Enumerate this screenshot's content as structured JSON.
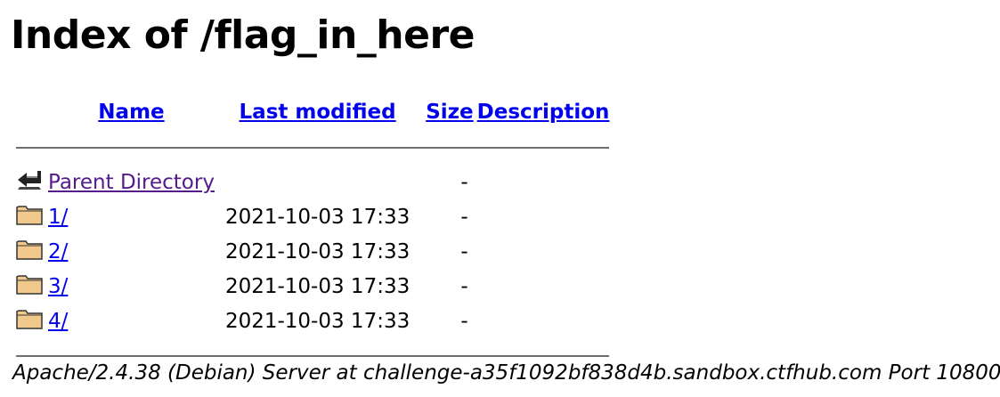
{
  "page": {
    "title": "Index of /flag_in_here"
  },
  "columns": {
    "name": "Name",
    "last_modified": "Last modified",
    "size": "Size",
    "description": "Description"
  },
  "rows": [
    {
      "icon": "back-icon",
      "name": "Parent Directory",
      "modified": "",
      "size": "-",
      "description": ""
    },
    {
      "icon": "folder-icon",
      "name": "1/",
      "modified": "2021-10-03 17:33",
      "size": "-",
      "description": ""
    },
    {
      "icon": "folder-icon",
      "name": "2/",
      "modified": "2021-10-03 17:33",
      "size": "-",
      "description": ""
    },
    {
      "icon": "folder-icon",
      "name": "3/",
      "modified": "2021-10-03 17:33",
      "size": "-",
      "description": ""
    },
    {
      "icon": "folder-icon",
      "name": "4/",
      "modified": "2021-10-03 17:33",
      "size": "-",
      "description": ""
    }
  ],
  "footer": {
    "address": "Apache/2.4.38 (Debian) Server at challenge-a35f1092bf838d4b.sandbox.ctfhub.com Port 10800"
  },
  "colors": {
    "link": "#0000ee",
    "visited_link": "#551a8b",
    "folder_fill": "#f2c98d",
    "rule": "#6e6e6e"
  }
}
